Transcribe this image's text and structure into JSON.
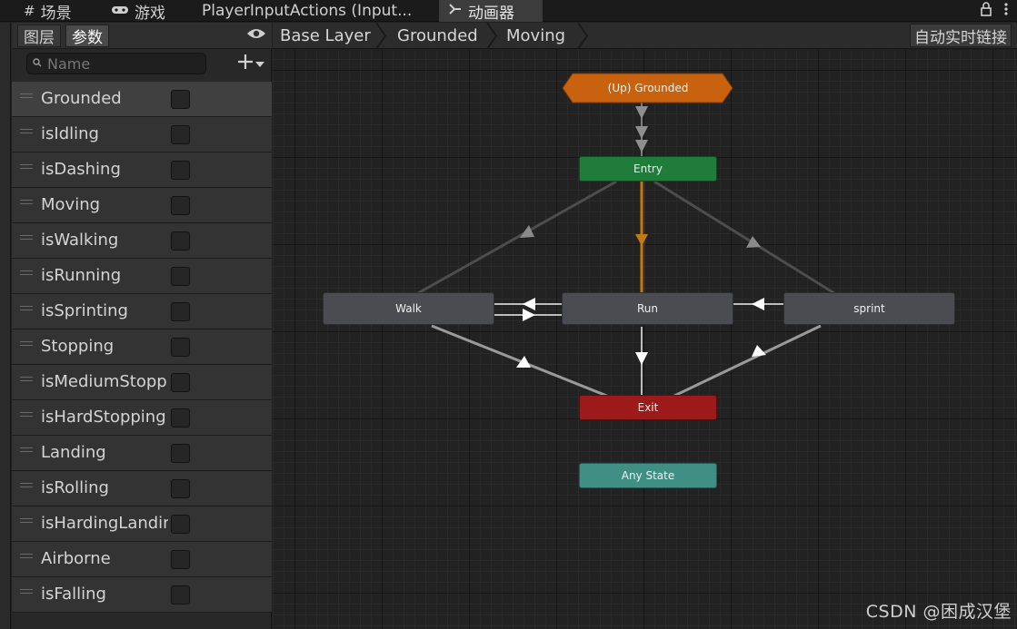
{
  "tabs": [
    {
      "icon": "#",
      "label": "场景"
    },
    {
      "icon": "gamepad-icon",
      "label": "游戏"
    },
    {
      "icon": "",
      "label": "PlayerInputActions (Input..."
    },
    {
      "icon": "animator-icon",
      "label": "动画器",
      "active": true
    }
  ],
  "panel": {
    "layers_label": "图层",
    "params_label": "参数",
    "search_placeholder": "Name",
    "parameters": [
      {
        "name": "Grounded",
        "checked": false
      },
      {
        "name": "isIdling",
        "checked": false
      },
      {
        "name": "isDashing",
        "checked": false
      },
      {
        "name": "Moving",
        "checked": false
      },
      {
        "name": "isWalking",
        "checked": false
      },
      {
        "name": "isRunning",
        "checked": false
      },
      {
        "name": "isSprinting",
        "checked": false
      },
      {
        "name": "Stopping",
        "checked": false
      },
      {
        "name": "isMediumStopping",
        "checked": false
      },
      {
        "name": "isHardStopping",
        "checked": false
      },
      {
        "name": "Landing",
        "checked": false
      },
      {
        "name": "isRolling",
        "checked": false
      },
      {
        "name": "isHardingLanding",
        "checked": false
      },
      {
        "name": "Airborne",
        "checked": false
      },
      {
        "name": "isFalling",
        "checked": false
      }
    ]
  },
  "breadcrumb": [
    "Base Layer",
    "Grounded",
    "Moving"
  ],
  "auto_live_link": "自动实时链接",
  "graph": {
    "nodes": {
      "up": "(Up) Grounded",
      "entry": "Entry",
      "walk": "Walk",
      "run": "Run",
      "sprint": "sprint",
      "exit": "Exit",
      "any": "Any State"
    },
    "colors": {
      "up": "#c8620e",
      "entry": "#1f7c3b",
      "exit": "#9d1a1a",
      "any": "#3f8f85",
      "state": "#4a4c52",
      "default_transition": "#c07a10"
    }
  },
  "watermark": "CSDN @困成汉堡"
}
